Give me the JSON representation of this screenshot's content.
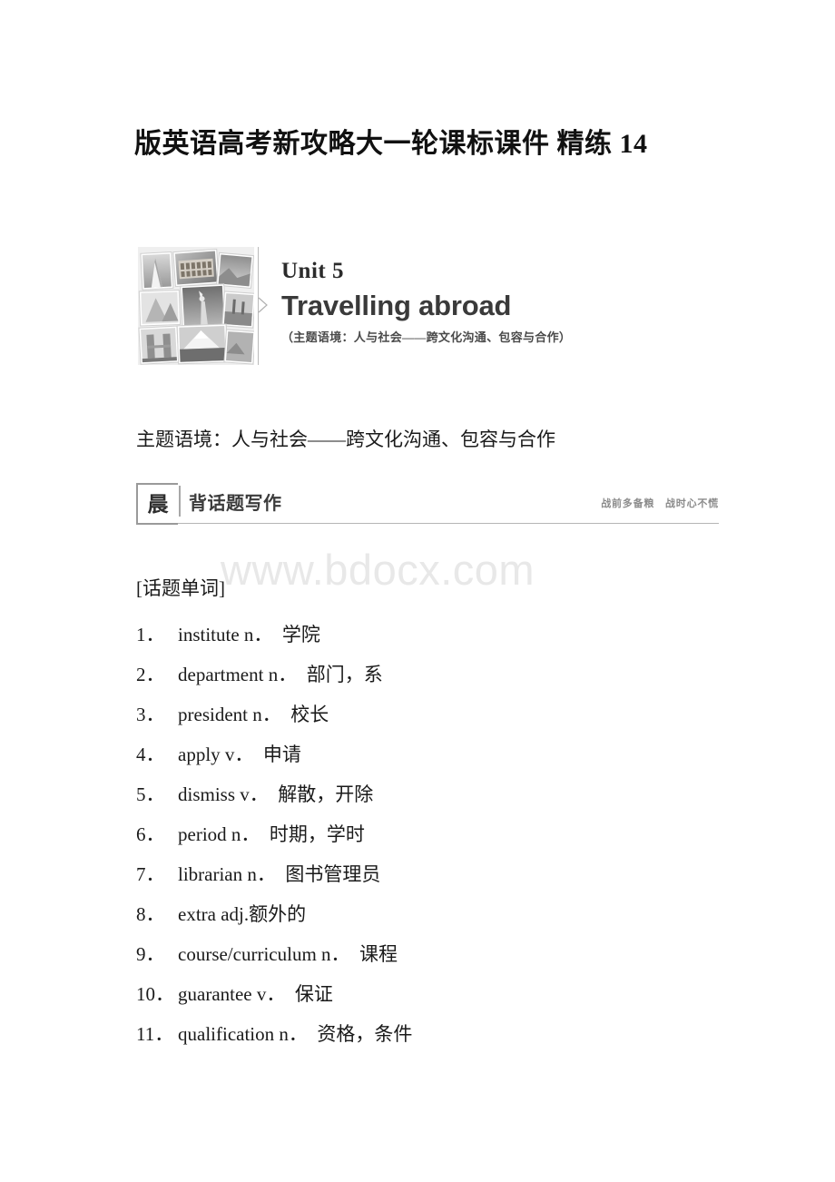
{
  "document": {
    "title": "版英语高考新攻略大一轮课标课件 精练 14",
    "watermark": "www.bdocx.com"
  },
  "unit_banner": {
    "collage_alt": "landmark-photo-collage",
    "unit_number": "Unit 5",
    "unit_name": "Travelling abroad",
    "unit_subtitle": "（主题语境：人与社会——跨文化沟通、包容与合作）"
  },
  "theme_line": "主题语境：人与社会——跨文化沟通、包容与合作",
  "section_banner": {
    "badge": "晨",
    "title": "背话题写作",
    "motto": "战前多备粮　战时心不慌"
  },
  "vocabulary": {
    "heading": "[话题单词]",
    "items": [
      {
        "num": "1．",
        "en": "institute n．",
        "zh": "学院"
      },
      {
        "num": "2．",
        "en": "department n．",
        "zh": "部门，系"
      },
      {
        "num": "3．",
        "en": "president n．",
        "zh": "校长"
      },
      {
        "num": "4．",
        "en": "apply v．",
        "zh": "申请"
      },
      {
        "num": "5．",
        "en": "dismiss v．",
        "zh": "解散，开除"
      },
      {
        "num": "6．",
        "en": "period n．",
        "zh": "时期，学时"
      },
      {
        "num": "7．",
        "en": "librarian n．",
        "zh": "图书管理员"
      },
      {
        "num": "8．",
        "en": "extra adj.",
        "zh": "额外的"
      },
      {
        "num": "9．",
        "en": "course/curriculum n．",
        "zh": "课程"
      },
      {
        "num": "10．",
        "en": "guarantee v．",
        "zh": "保证"
      },
      {
        "num": "11．",
        "en": "qualification n．",
        "zh": "资格，条件"
      }
    ]
  }
}
